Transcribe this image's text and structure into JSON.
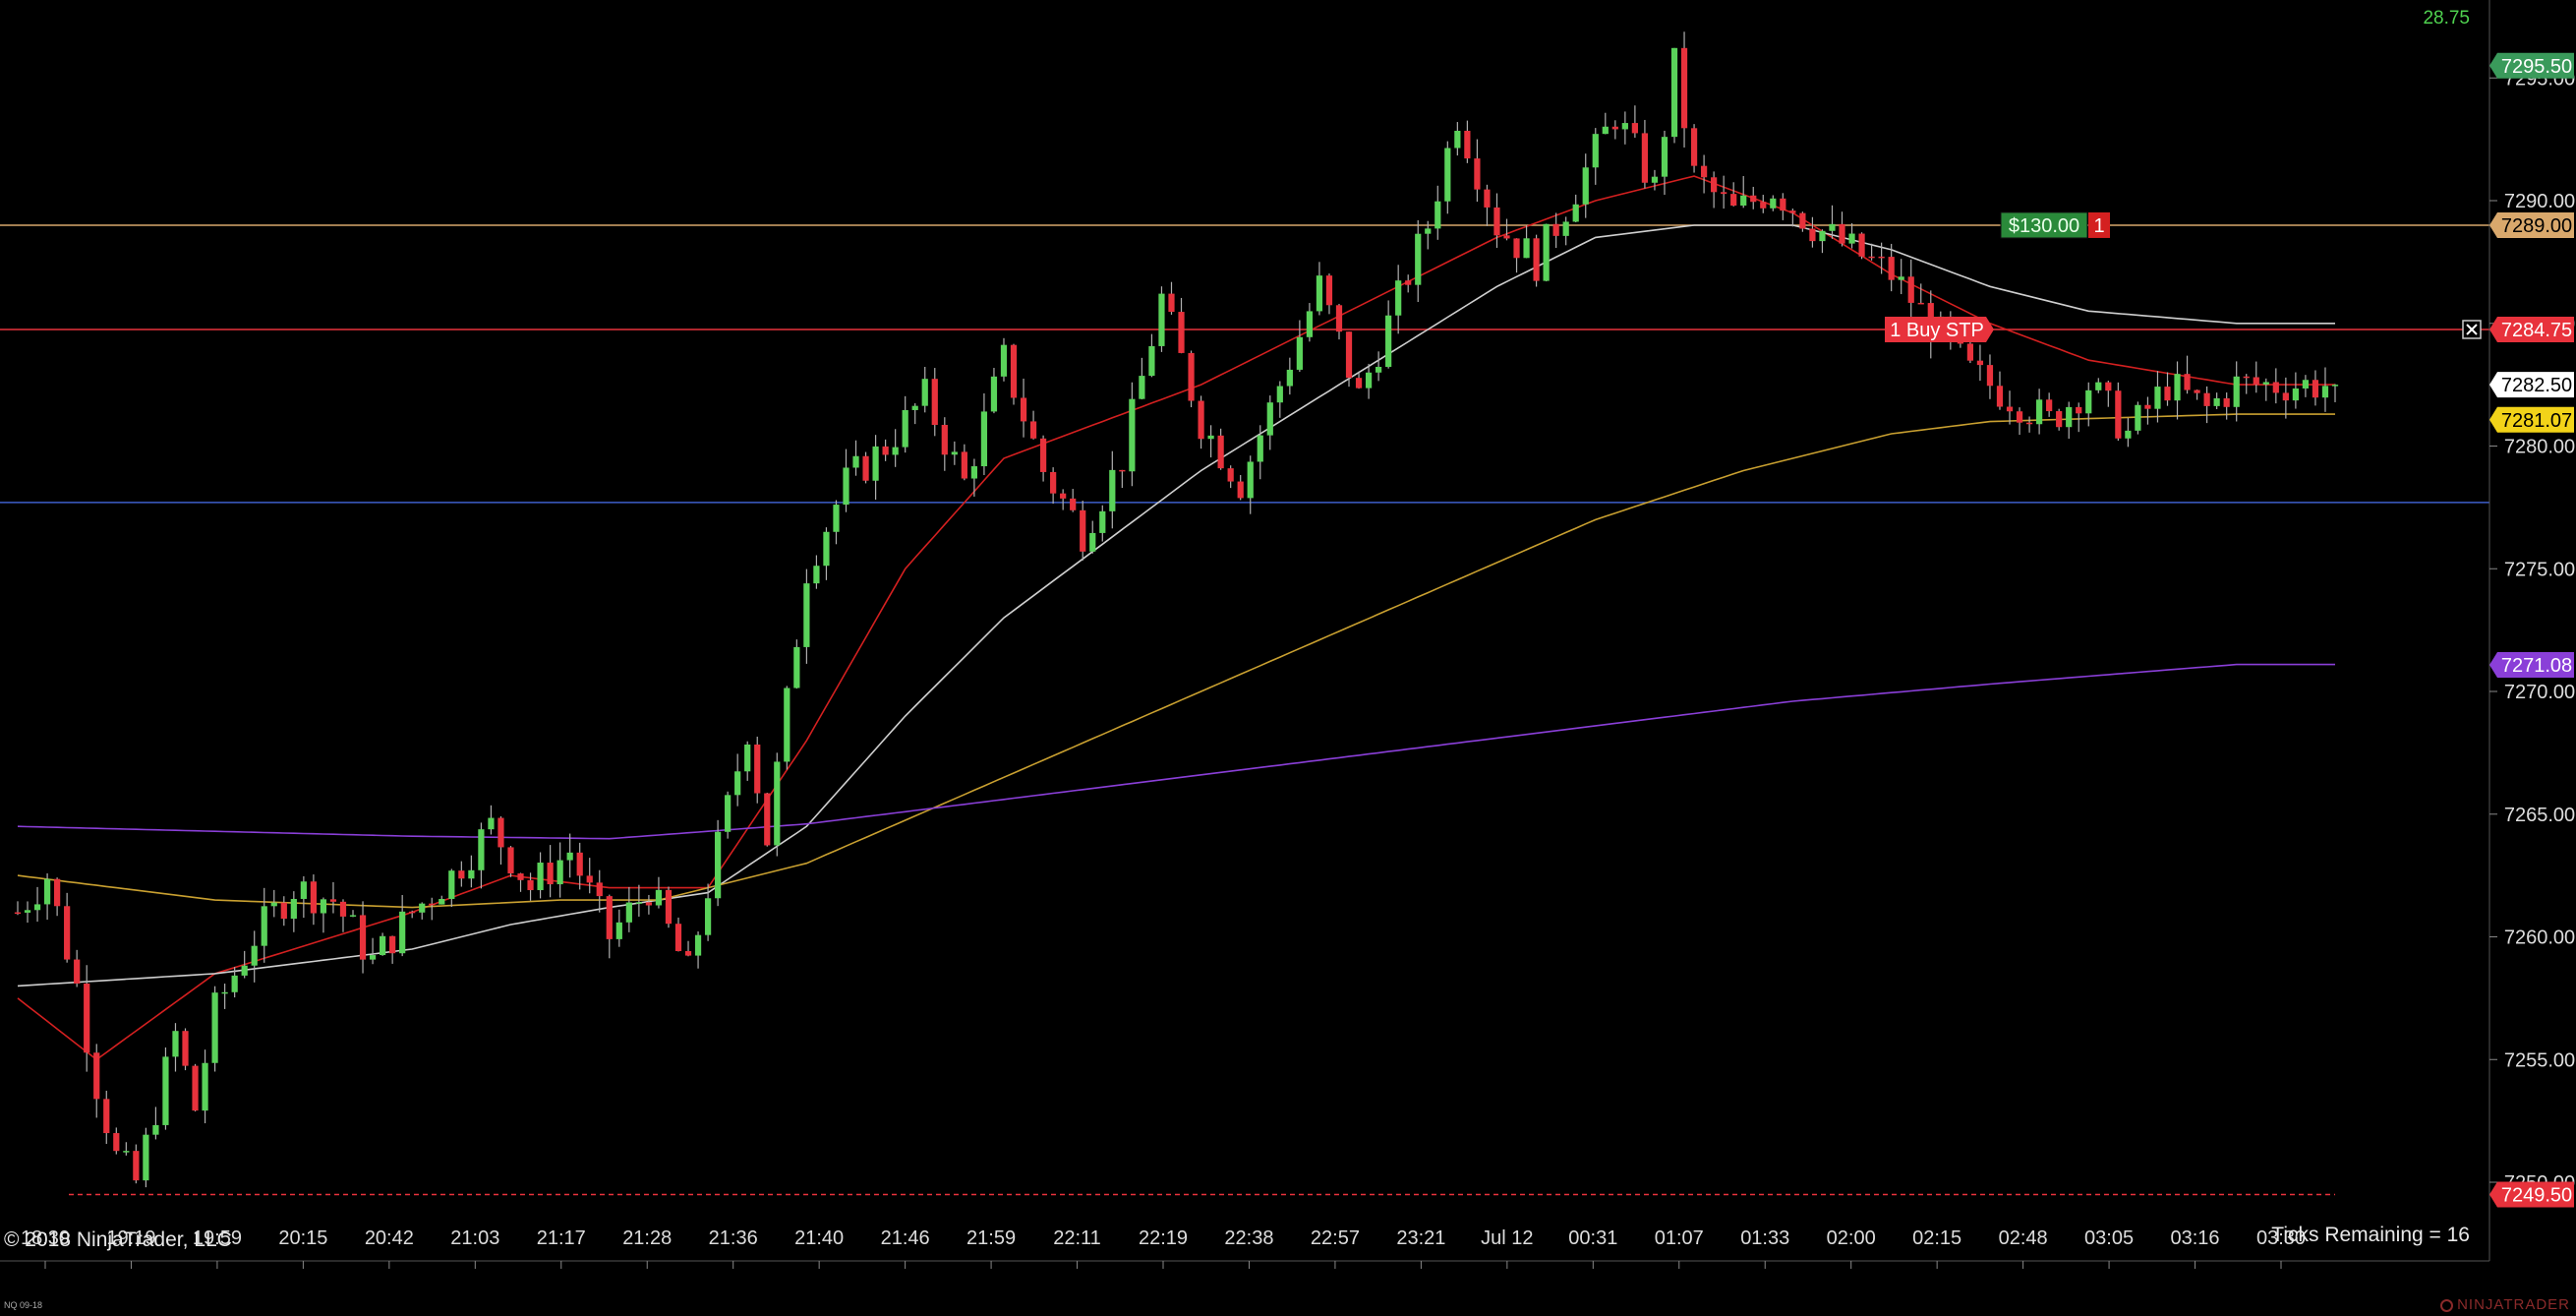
{
  "header": {
    "top_right_value": "28.75"
  },
  "footer": {
    "copyright": "© 2018 NinjaTrader, LLC",
    "ticks_remaining": "Ticks Remaining = 16",
    "instrument_tiny": "NQ 09-18",
    "brand": "NINJATRADER"
  },
  "colors": {
    "bull": "#5ad35a",
    "bear": "#e8323c",
    "ema_fast": "#d42020",
    "ema_mid": "#cfcfcf",
    "ema_slow": "#c9a030",
    "ema_long": "#8a3fd8",
    "hline": "#3d5ec9",
    "target": "#d9a86c"
  },
  "chart_data": {
    "type": "candlestick",
    "instrument": "NQ 09-18",
    "ylim": [
      7248.5,
      7296.5
    ],
    "y_ticks": [
      "7250.00",
      "7255.00",
      "7260.00",
      "7265.00",
      "7270.00",
      "7275.00",
      "7280.00",
      "7285.00",
      "7290.00",
      "7295.00"
    ],
    "x_ticks": [
      "18:30",
      "19:19",
      "19:59",
      "20:15",
      "20:42",
      "21:03",
      "21:17",
      "21:28",
      "21:36",
      "21:40",
      "21:46",
      "21:59",
      "22:11",
      "22:19",
      "22:38",
      "22:57",
      "23:21",
      "Jul 12",
      "00:31",
      "01:07",
      "01:33",
      "02:00",
      "02:15",
      "02:48",
      "03:05",
      "03:16",
      "03:30"
    ],
    "bars_count": 236,
    "path_points": [
      [
        0,
        7261
      ],
      [
        3,
        7262.5
      ],
      [
        6,
        7258
      ],
      [
        8,
        7254
      ],
      [
        10,
        7251
      ],
      [
        12,
        7250
      ],
      [
        14,
        7253
      ],
      [
        16,
        7256
      ],
      [
        18,
        7253
      ],
      [
        20,
        7257
      ],
      [
        24,
        7260
      ],
      [
        28,
        7262
      ],
      [
        32,
        7261.5
      ],
      [
        36,
        7259
      ],
      [
        40,
        7261
      ],
      [
        44,
        7262.5
      ],
      [
        48,
        7264.5
      ],
      [
        52,
        7262
      ],
      [
        56,
        7263.5
      ],
      [
        60,
        7260
      ],
      [
        64,
        7262
      ],
      [
        68,
        7258.5
      ],
      [
        70,
        7262
      ],
      [
        74,
        7268.5
      ],
      [
        76,
        7264
      ],
      [
        80,
        7275
      ],
      [
        84,
        7278.5
      ],
      [
        88,
        7280
      ],
      [
        92,
        7282
      ],
      [
        96,
        7278.5
      ],
      [
        100,
        7283.5
      ],
      [
        104,
        7279
      ],
      [
        108,
        7276.5
      ],
      [
        112,
        7279.5
      ],
      [
        116,
        7286
      ],
      [
        120,
        7281
      ],
      [
        124,
        7278.5
      ],
      [
        128,
        7282.5
      ],
      [
        132,
        7286.5
      ],
      [
        136,
        7282
      ],
      [
        140,
        7286
      ],
      [
        143,
        7289
      ],
      [
        146,
        7293.5
      ],
      [
        150,
        7289
      ],
      [
        154,
        7287.5
      ],
      [
        158,
        7290.5
      ],
      [
        162,
        7293.5
      ],
      [
        166,
        7290.5
      ],
      [
        168,
        7295.5
      ],
      [
        170,
        7291
      ],
      [
        174,
        7289.5
      ],
      [
        178,
        7290.5
      ],
      [
        182,
        7289
      ],
      [
        186,
        7288
      ],
      [
        190,
        7287
      ],
      [
        194,
        7285
      ],
      [
        198,
        7283
      ],
      [
        202,
        7282
      ],
      [
        206,
        7281
      ],
      [
        210,
        7282.5
      ],
      [
        214,
        7280.5
      ],
      [
        218,
        7282.5
      ],
      [
        222,
        7281.5
      ],
      [
        225,
        7282.5
      ]
    ],
    "indicators": [
      {
        "name": "ema_fast",
        "color": "#d42020",
        "points": [
          [
            0,
            7257.5
          ],
          [
            8,
            7255
          ],
          [
            20,
            7258.5
          ],
          [
            40,
            7261
          ],
          [
            50,
            7262.5
          ],
          [
            60,
            7262
          ],
          [
            70,
            7262
          ],
          [
            80,
            7268
          ],
          [
            90,
            7275
          ],
          [
            100,
            7279.5
          ],
          [
            110,
            7281
          ],
          [
            120,
            7282.5
          ],
          [
            130,
            7284.5
          ],
          [
            140,
            7286.5
          ],
          [
            150,
            7288.5
          ],
          [
            160,
            7290
          ],
          [
            170,
            7291
          ],
          [
            180,
            7289.5
          ],
          [
            190,
            7287
          ],
          [
            200,
            7285
          ],
          [
            210,
            7283.5
          ],
          [
            225,
            7282.5
          ]
        ]
      },
      {
        "name": "ema_mid",
        "color": "#cfcfcf",
        "points": [
          [
            0,
            7258
          ],
          [
            20,
            7258.5
          ],
          [
            40,
            7259.5
          ],
          [
            50,
            7260.5
          ],
          [
            60,
            7261.2
          ],
          [
            70,
            7261.8
          ],
          [
            80,
            7264.5
          ],
          [
            90,
            7269
          ],
          [
            100,
            7273
          ],
          [
            110,
            7276
          ],
          [
            120,
            7279
          ],
          [
            130,
            7281.5
          ],
          [
            140,
            7284
          ],
          [
            150,
            7286.5
          ],
          [
            160,
            7288.5
          ],
          [
            170,
            7289
          ],
          [
            180,
            7289
          ],
          [
            190,
            7288
          ],
          [
            200,
            7286.5
          ],
          [
            210,
            7285.5
          ],
          [
            225,
            7285
          ]
        ]
      },
      {
        "name": "ema_slow",
        "color": "#c9a030",
        "points": [
          [
            0,
            7262.5
          ],
          [
            20,
            7261.5
          ],
          [
            40,
            7261.2
          ],
          [
            55,
            7261.5
          ],
          [
            65,
            7261.5
          ],
          [
            80,
            7263
          ],
          [
            100,
            7266.5
          ],
          [
            120,
            7270
          ],
          [
            140,
            7273.5
          ],
          [
            160,
            7277
          ],
          [
            175,
            7279
          ],
          [
            190,
            7280.5
          ],
          [
            200,
            7281
          ],
          [
            225,
            7281.3
          ]
        ]
      },
      {
        "name": "ema_long",
        "color": "#8a3fd8",
        "points": [
          [
            0,
            7264.5
          ],
          [
            20,
            7264.3
          ],
          [
            40,
            7264.1
          ],
          [
            60,
            7264
          ],
          [
            80,
            7264.6
          ],
          [
            100,
            7265.6
          ],
          [
            120,
            7266.6
          ],
          [
            140,
            7267.6
          ],
          [
            160,
            7268.6
          ],
          [
            180,
            7269.6
          ],
          [
            200,
            7270.3
          ],
          [
            225,
            7271.1
          ]
        ]
      }
    ],
    "horizontal_lines": [
      {
        "y": 7277.7,
        "color": "#3d5ec9",
        "style": "solid"
      },
      {
        "y": 7284.75,
        "color": "#e8323c",
        "style": "solid"
      },
      {
        "y": 7289.0,
        "color": "#d9a86c",
        "style": "solid"
      },
      {
        "y": 7249.5,
        "color": "#e8323c",
        "style": "dashed"
      }
    ],
    "price_tags": [
      {
        "label": "7295.50",
        "y": 7295.5,
        "bg": "#3a9a5b",
        "fg": "#ffffff"
      },
      {
        "label": "7289.00",
        "y": 7289.0,
        "bg": "#d9a86c",
        "fg": "#000000"
      },
      {
        "label": "7284.75",
        "y": 7284.75,
        "bg": "#e8323c",
        "fg": "#ffffff"
      },
      {
        "label": "7282.50",
        "y": 7282.5,
        "bg": "#ffffff",
        "fg": "#000000"
      },
      {
        "label": "7281.07",
        "y": 7281.07,
        "bg": "#f2d319",
        "fg": "#000000"
      },
      {
        "label": "7271.08",
        "y": 7271.08,
        "bg": "#8a3fd8",
        "fg": "#ffffff"
      },
      {
        "label": "7249.50",
        "y": 7249.5,
        "bg": "#e8323c",
        "fg": "#ffffff"
      }
    ],
    "orders": [
      {
        "label": "1 Buy STP",
        "y": 7284.75,
        "color": "#e8323c"
      },
      {
        "label": "$130.00",
        "qty": "1",
        "y": 7289.0,
        "color": "#2a8a3a"
      }
    ],
    "grid": false
  }
}
